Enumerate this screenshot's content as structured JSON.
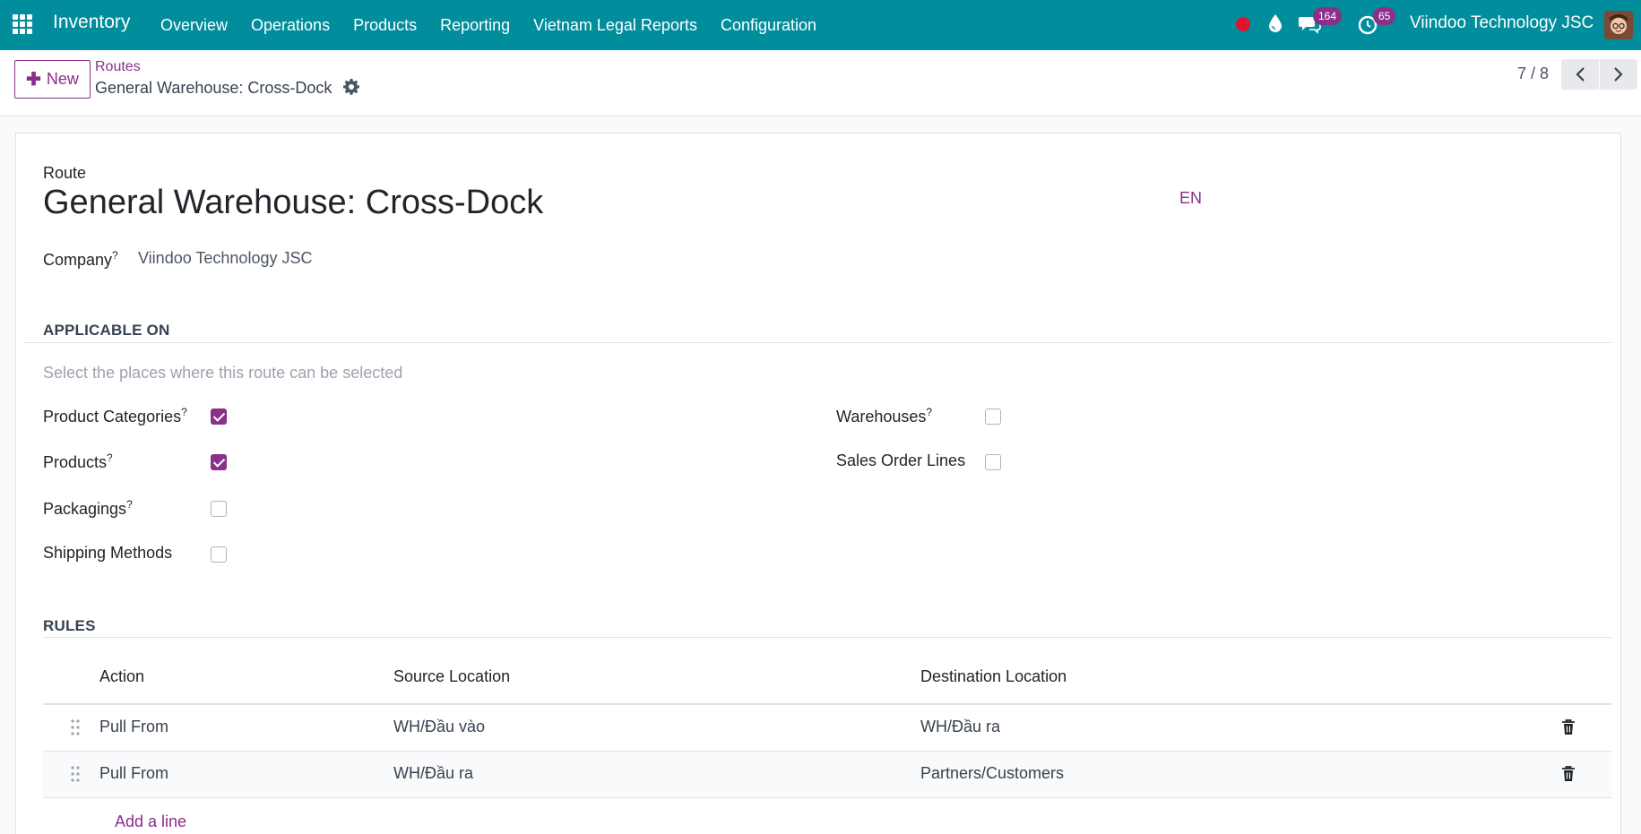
{
  "navbar": {
    "app_name": "Inventory",
    "menu": [
      "Overview",
      "Operations",
      "Products",
      "Reporting",
      "Vietnam Legal Reports",
      "Configuration"
    ],
    "chat_count": "164",
    "activity_count": "65",
    "company": "Viindoo Technology JSC",
    "colors": {
      "bar": "#018d9c",
      "badge": "#8a2f8a",
      "record": "#e0142a"
    }
  },
  "control": {
    "new_label": "New",
    "breadcrumb_parent": "Routes",
    "breadcrumb_current": "General Warehouse: Cross-Dock",
    "pager": "7 / 8"
  },
  "form": {
    "route_label": "Route",
    "route_name": "General Warehouse: Cross-Dock",
    "lang": "EN",
    "company_label": "Company",
    "company_value": "Viindoo Technology JSC",
    "applicable_title": "APPLICABLE ON",
    "applicable_hint": "Select the places where this route can be selected",
    "applicable": {
      "product_categories": {
        "label": "Product Categories",
        "help": "?",
        "checked": true
      },
      "products": {
        "label": "Products",
        "help": "?",
        "checked": true
      },
      "packagings": {
        "label": "Packagings",
        "help": "?",
        "checked": false
      },
      "shipping_methods": {
        "label": "Shipping Methods",
        "checked": false
      },
      "warehouses": {
        "label": "Warehouses",
        "help": "?",
        "checked": false
      },
      "sales_order_lines": {
        "label": "Sales Order Lines",
        "checked": false
      }
    },
    "rules_title": "RULES",
    "rules_headers": {
      "action": "Action",
      "source": "Source Location",
      "destination": "Destination Location"
    },
    "rules": [
      {
        "action": "Pull From",
        "source": "WH/Đầu vào",
        "destination": "WH/Đầu ra"
      },
      {
        "action": "Pull From",
        "source": "WH/Đầu ra",
        "destination": "Partners/Customers"
      }
    ],
    "add_line": "Add a line",
    "accent_color": "#8a2f8a"
  }
}
